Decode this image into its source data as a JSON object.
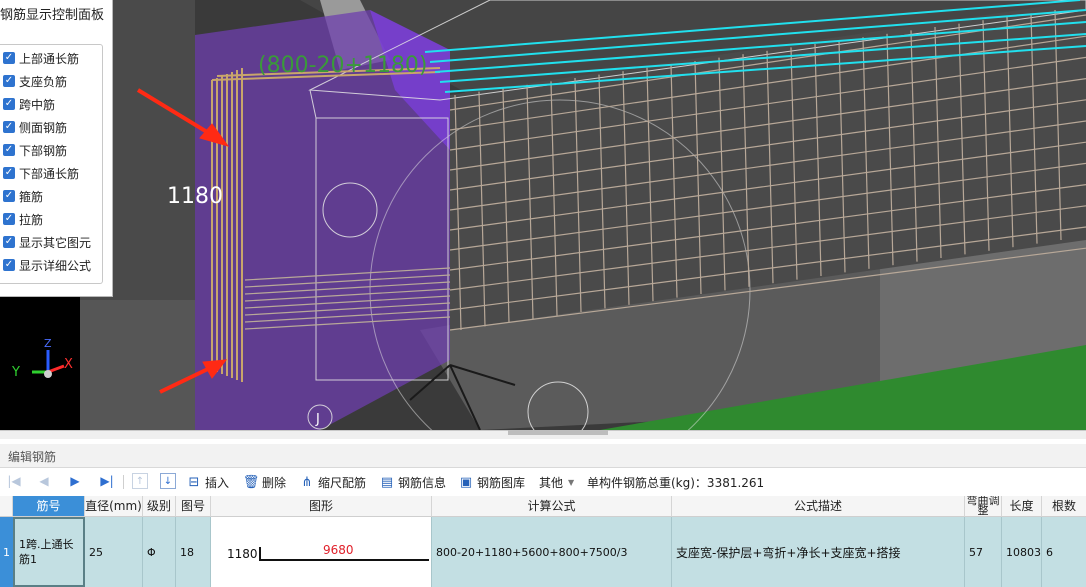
{
  "panel": {
    "title": "钢筋显示控制面板",
    "items": [
      {
        "label": "上部通长筋",
        "checked": true
      },
      {
        "label": "支座负筋",
        "checked": true
      },
      {
        "label": "跨中筋",
        "checked": true
      },
      {
        "label": "侧面钢筋",
        "checked": true
      },
      {
        "label": "下部钢筋",
        "checked": true
      },
      {
        "label": "下部通长筋",
        "checked": true
      },
      {
        "label": "箍筋",
        "checked": true
      },
      {
        "label": "拉筋",
        "checked": true
      },
      {
        "label": "显示其它图元",
        "checked": true
      },
      {
        "label": "显示详细公式",
        "checked": true
      }
    ]
  },
  "viewport": {
    "formula_label": "(800-20+1180)",
    "dimension_label": "1180",
    "axis_x": "X",
    "axis_y": "Y",
    "axis_z": "Z",
    "marker_label": "J",
    "colors": {
      "highlight": "#6e3fae",
      "selected_bar": "#21e0ee",
      "rebar": "#b8a898",
      "formula_text": "#3a9a3a"
    }
  },
  "editor": {
    "section_title": "编辑钢筋",
    "toolbar": {
      "insert": "插入",
      "delete": "删除",
      "scale_rebar": "缩尺配筋",
      "rebar_info": "钢筋信息",
      "rebar_library": "钢筋图库",
      "other": "其他",
      "total_weight": "单构件钢筋总重(kg)：3381.261"
    },
    "columns": {
      "bar_no": "筋号",
      "diameter": "直径(mm)",
      "grade": "级别",
      "shape_no": "图号",
      "shape": "图形",
      "formula": "计算公式",
      "description": "公式描述",
      "bend_adjust": "弯曲调整",
      "length": "长度",
      "count": "根数"
    },
    "rows": [
      {
        "index": "1",
        "bar_no": "1跨.上通长筋1",
        "diameter": "25",
        "grade": "Φ",
        "shape_no": "18",
        "shape_left": "1180",
        "shape_top": "9680",
        "formula": "800-20+1180+5600+800+7500/3",
        "description": "支座宽-保护层+弯折+净长+支座宽+搭接",
        "bend_adjust": "57",
        "length": "10803",
        "count": "6"
      }
    ]
  }
}
